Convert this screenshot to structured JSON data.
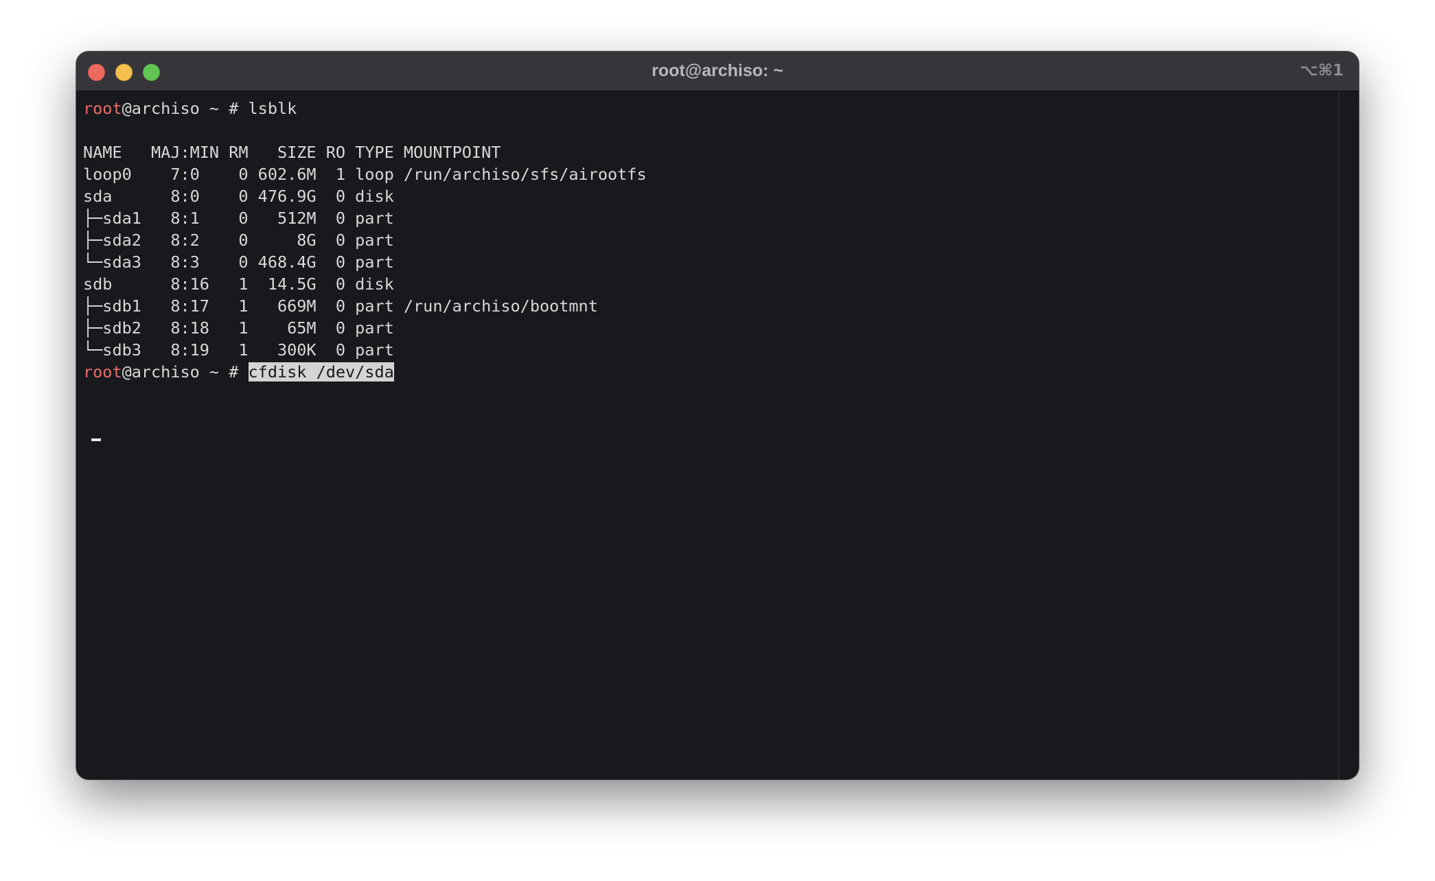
{
  "window": {
    "title": "root@archiso: ~",
    "shortcut": "⌥⌘1"
  },
  "terminal": {
    "prompt": {
      "user": "root",
      "host_path": "@archiso ~ # "
    },
    "command1": "lsblk",
    "header": "NAME   MAJ:MIN RM   SIZE RO TYPE MOUNTPOINT",
    "rows": [
      "loop0    7:0    0 602.6M  1 loop /run/archiso/sfs/airootfs",
      "sda      8:0    0 476.9G  0 disk ",
      "├─sda1   8:1    0   512M  0 part ",
      "├─sda2   8:2    0     8G  0 part ",
      "└─sda3   8:3    0 468.4G  0 part ",
      "sdb      8:16   1  14.5G  0 disk ",
      "├─sdb1   8:17   1   669M  0 part /run/archiso/bootmnt",
      "├─sdb2   8:18   1    65M  0 part ",
      "└─sdb3   8:19   1   300K  0 part "
    ],
    "command2": "cfdisk /dev/sda"
  },
  "colors": {
    "background": "#17191d",
    "titlebar": "#36363a",
    "prompt_user": "#ed6b6b",
    "text": "#d9d9d9"
  }
}
